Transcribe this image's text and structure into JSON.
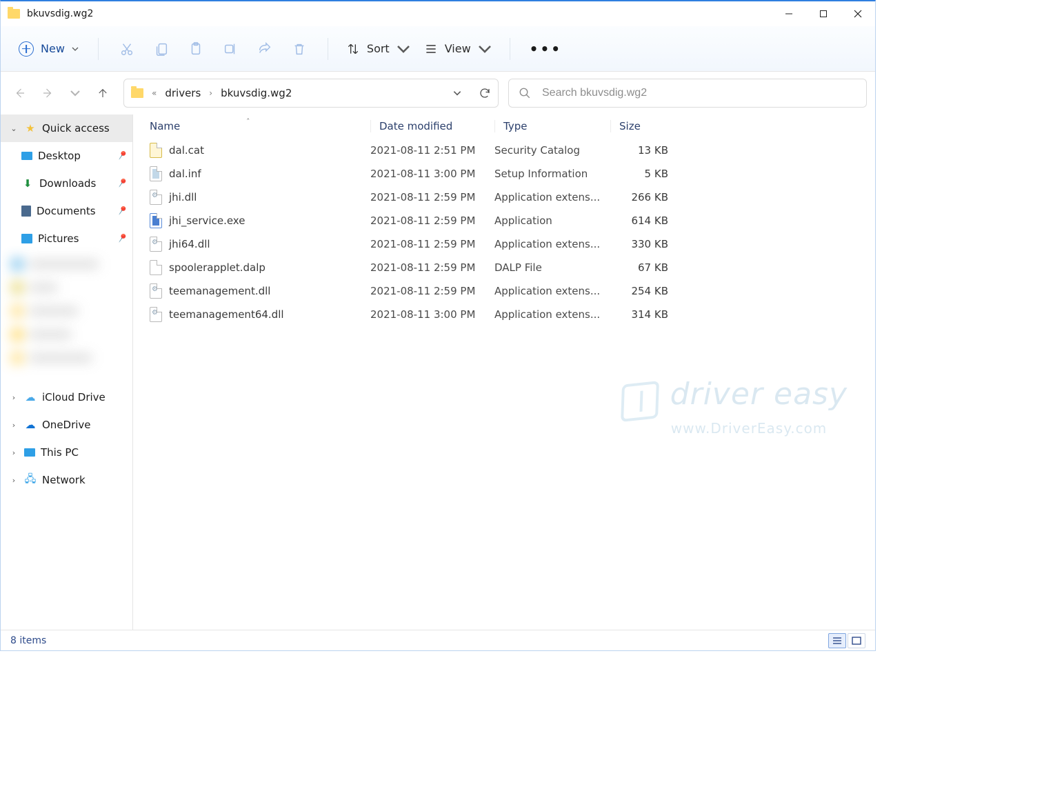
{
  "window": {
    "title": "bkuvsdig.wg2"
  },
  "toolbar": {
    "new_label": "New",
    "sort_label": "Sort",
    "view_label": "View"
  },
  "breadcrumb": {
    "parent": "drivers",
    "current": "bkuvsdig.wg2"
  },
  "search": {
    "placeholder": "Search bkuvsdig.wg2"
  },
  "sidebar": {
    "quick_access": "Quick access",
    "pinned": [
      "Desktop",
      "Downloads",
      "Documents",
      "Pictures"
    ],
    "roots": [
      "iCloud Drive",
      "OneDrive",
      "This PC",
      "Network"
    ]
  },
  "columns": {
    "name": "Name",
    "date": "Date modified",
    "type": "Type",
    "size": "Size"
  },
  "files": [
    {
      "name": "dal.cat",
      "icon": "cat",
      "date": "2021-08-11 2:51 PM",
      "type": "Security Catalog",
      "size": "13 KB"
    },
    {
      "name": "dal.inf",
      "icon": "inf",
      "date": "2021-08-11 3:00 PM",
      "type": "Setup Information",
      "size": "5 KB"
    },
    {
      "name": "jhi.dll",
      "icon": "dll",
      "date": "2021-08-11 2:59 PM",
      "type": "Application extens...",
      "size": "266 KB"
    },
    {
      "name": "jhi_service.exe",
      "icon": "exe",
      "date": "2021-08-11 2:59 PM",
      "type": "Application",
      "size": "614 KB"
    },
    {
      "name": "jhi64.dll",
      "icon": "dll",
      "date": "2021-08-11 2:59 PM",
      "type": "Application extens...",
      "size": "330 KB"
    },
    {
      "name": "spoolerapplet.dalp",
      "icon": "gen",
      "date": "2021-08-11 2:59 PM",
      "type": "DALP File",
      "size": "67 KB"
    },
    {
      "name": "teemanagement.dll",
      "icon": "dll",
      "date": "2021-08-11 2:59 PM",
      "type": "Application extens...",
      "size": "254 KB"
    },
    {
      "name": "teemanagement64.dll",
      "icon": "dll",
      "date": "2021-08-11 3:00 PM",
      "type": "Application extens...",
      "size": "314 KB"
    }
  ],
  "watermark": {
    "line1": "driver easy",
    "line2": "www.DriverEasy.com"
  },
  "status": {
    "text": "8 items"
  }
}
